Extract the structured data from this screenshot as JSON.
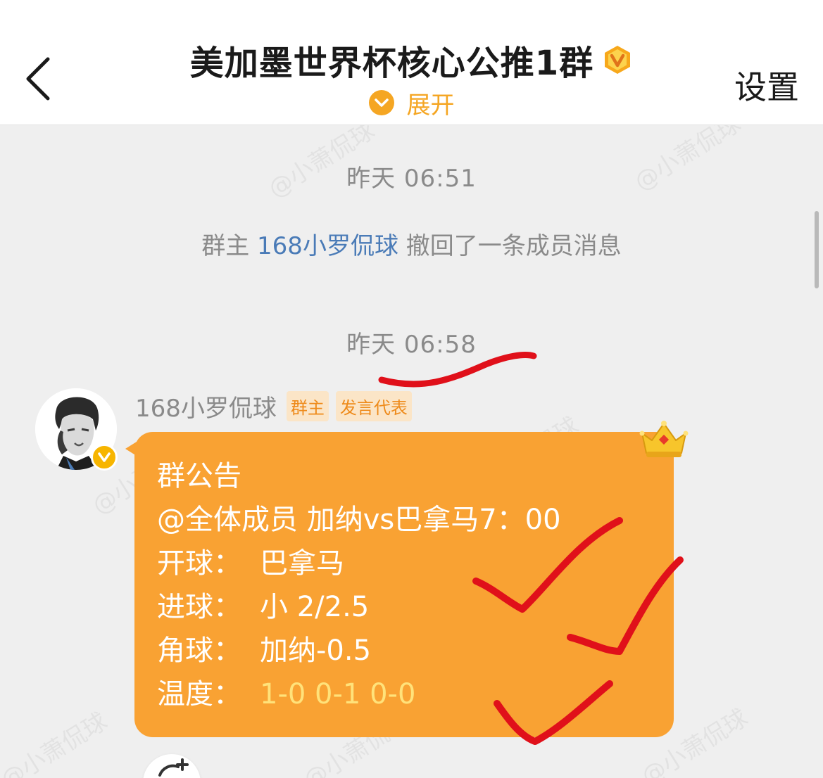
{
  "header": {
    "title": "美加墨世界杯核心公推1群",
    "expand_label": "展开",
    "settings_label": "设置"
  },
  "watermark": "@小萧侃球",
  "chat": {
    "timestamp_1": "昨天 06:51",
    "system_message": {
      "prefix": "群主 ",
      "owner_name": "168小罗侃球",
      "suffix": " 撤回了一条成员消息"
    },
    "timestamp_2": "昨天 06:58",
    "message": {
      "sender_name": "168小罗侃球",
      "tags": [
        "群主",
        "发言代表"
      ],
      "bubble": {
        "heading": "群公告",
        "line_1": "@全体成员 加纳vs巴拿马7：00",
        "kickoff_label": "开球：",
        "kickoff_value": "巴拿马",
        "goals_label": "进球：",
        "goals_value": "小 2/2.5",
        "corners_label": "角球：",
        "corners_value": "加纳-0.5",
        "temp_label": "温度：",
        "temp_value": "1-0 0-1 0-0"
      }
    }
  },
  "colors": {
    "accent": "#f5a623",
    "bubble": "#f9a233",
    "link": "#4a7bb7",
    "annotation_ink": "#e0101a"
  },
  "icons": {
    "back": "chevron-left-icon",
    "vip": "vip-badge-icon",
    "expand": "chevron-down-circle-icon",
    "crown": "crown-icon",
    "add": "add-icon"
  }
}
